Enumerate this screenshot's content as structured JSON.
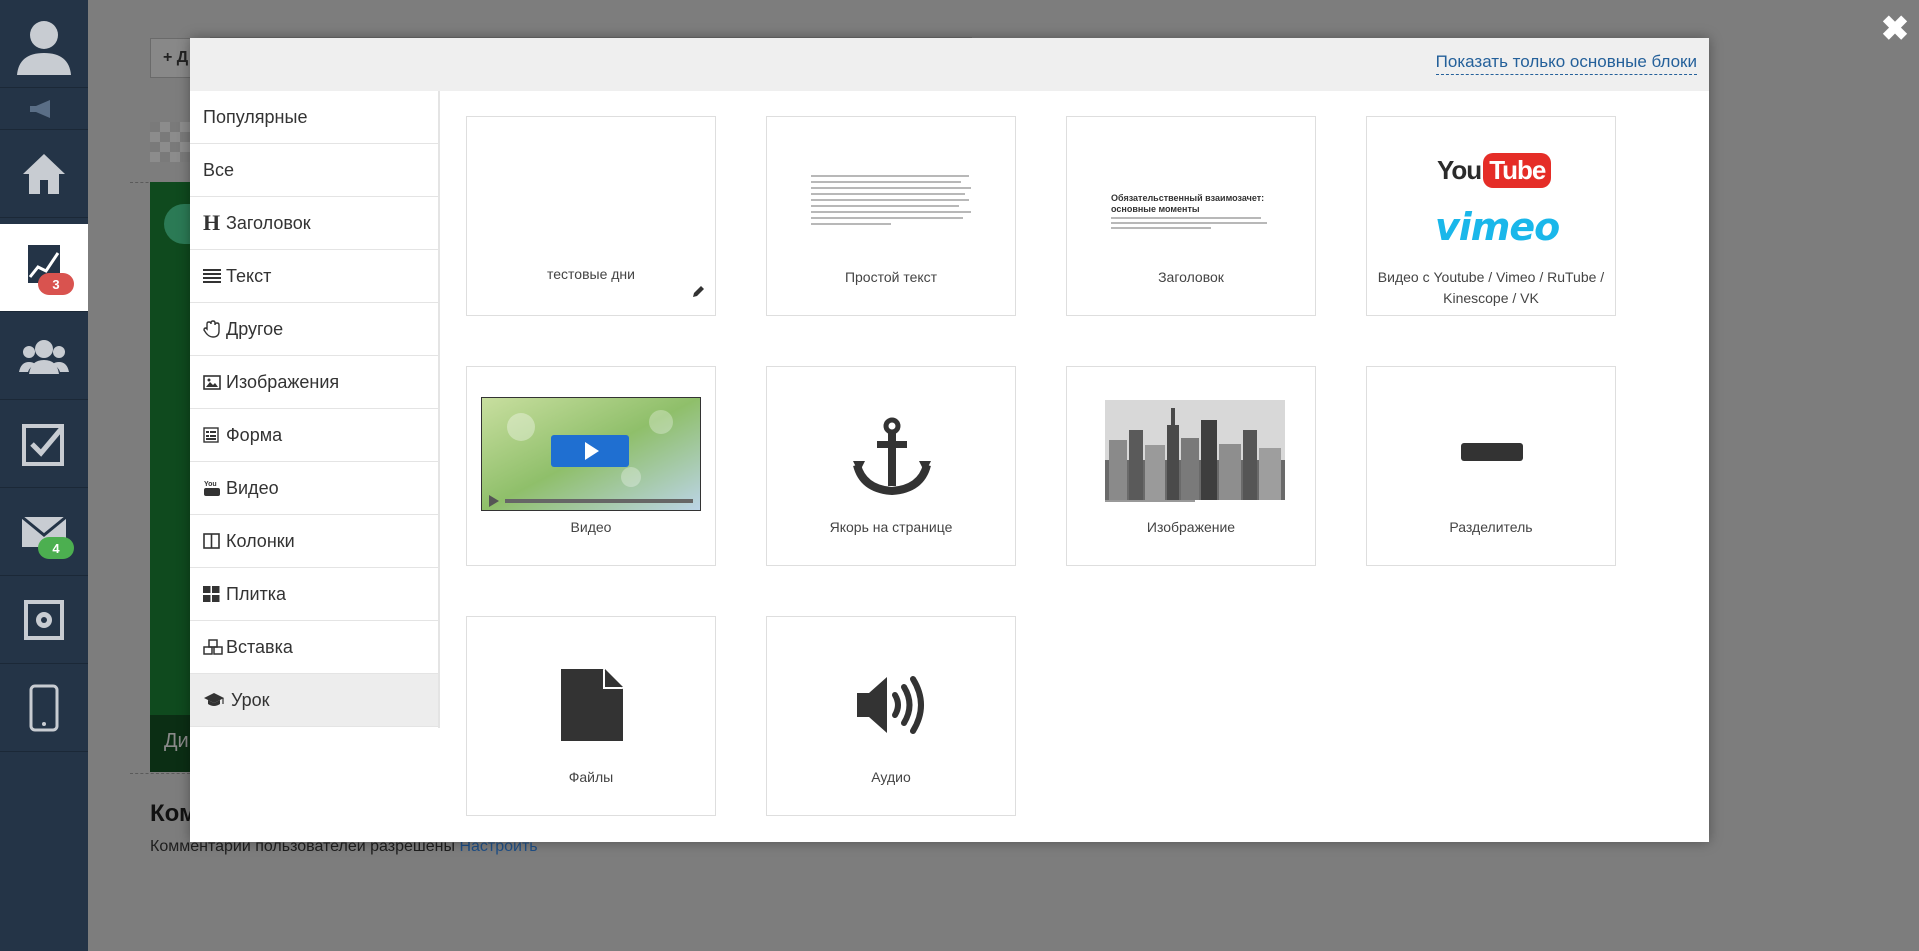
{
  "sidebar": {
    "badges": {
      "stats": "3",
      "mail": "4"
    }
  },
  "background": {
    "add_button_label": "+ Д",
    "green_block_text": "Ди",
    "comments_title": "Ком",
    "comments_text": "Комментарии пользователей разрешены",
    "comments_link": "Настроить"
  },
  "modal": {
    "show_basic_link": "Показать только основные блоки",
    "categories": [
      {
        "label": "Популярные",
        "icon": "none"
      },
      {
        "label": "Все",
        "icon": "none"
      },
      {
        "label": "Заголовок",
        "icon": "heading-icon"
      },
      {
        "label": "Текст",
        "icon": "text-lines-icon"
      },
      {
        "label": "Другое",
        "icon": "hand-icon"
      },
      {
        "label": "Изображения",
        "icon": "image-icon"
      },
      {
        "label": "Форма",
        "icon": "form-icon"
      },
      {
        "label": "Видео",
        "icon": "youtube-icon"
      },
      {
        "label": "Колонки",
        "icon": "columns-icon"
      },
      {
        "label": "Плитка",
        "icon": "tiles-icon"
      },
      {
        "label": "Вставка",
        "icon": "cubes-icon"
      },
      {
        "label": "Урок",
        "icon": "graduation-cap-icon"
      }
    ],
    "selected_category": "Урок",
    "tiles": [
      {
        "label": "тестовые дни"
      },
      {
        "label": "Простой текст"
      },
      {
        "label": "Заголовок",
        "preview_heading": "Обязательственный взаимозачет: основные моменты"
      },
      {
        "label": "Видео с Youtube / Vimeo / RuTube / Kinescope / VK",
        "youtube_text": "You",
        "youtube_tube": "Tube",
        "vimeo_text": "vimeo"
      },
      {
        "label": "Видео"
      },
      {
        "label": "Якорь на странице"
      },
      {
        "label": "Изображение"
      },
      {
        "label": "Разделитель"
      },
      {
        "label": "Файлы"
      },
      {
        "label": "Аудио"
      }
    ]
  },
  "colors": {
    "sidebar_bg": "#243447",
    "overlay_bg": "#7a7a7a",
    "link": "#24609a",
    "badge_red": "#d9534f",
    "badge_green": "#4caf50",
    "youtube_red": "#e52d27",
    "vimeo_blue": "#1ab7ea"
  }
}
